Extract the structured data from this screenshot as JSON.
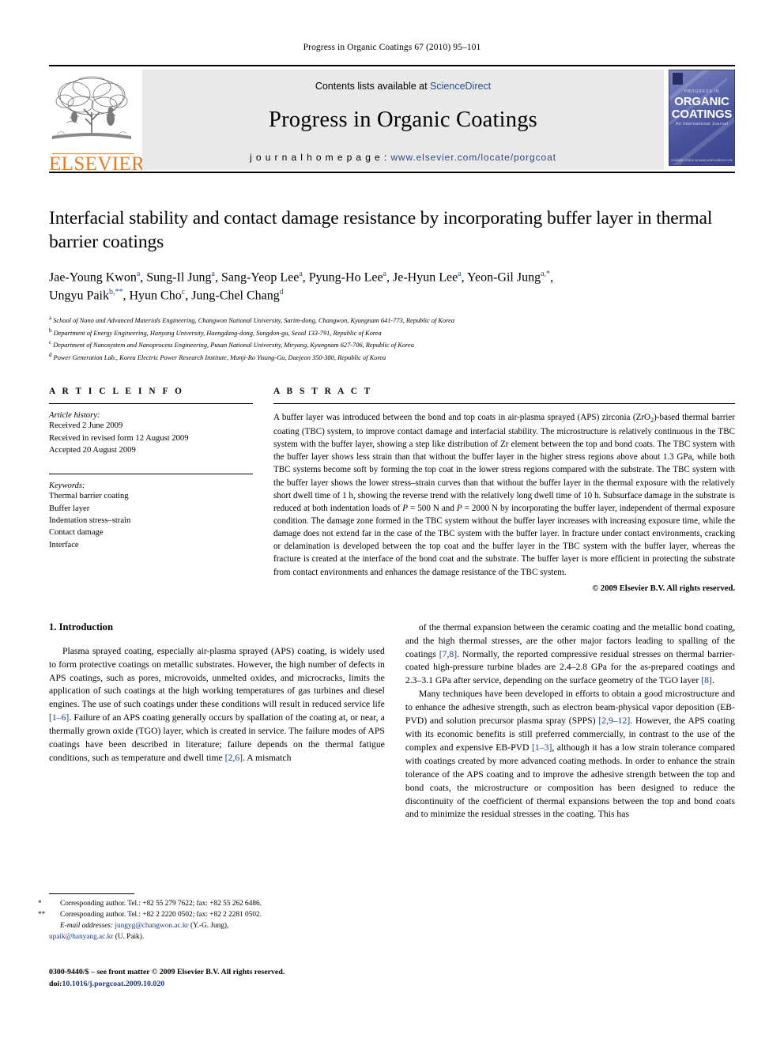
{
  "running_head": "Progress in Organic Coatings 67 (2010) 95–101",
  "masthead": {
    "contents_prefix": "Contents lists available at ",
    "sciencedirect": "ScienceDirect",
    "journal_title": "Progress in Organic Coatings",
    "homepage_prefix": "j o u r n a l   h o m e p a g e :   ",
    "homepage_url": "www.elsevier.com/locate/porgcoat",
    "publisher": "ELSEVIER",
    "cover": {
      "progress_in": "PROGRESS IN",
      "organic": "ORGANIC",
      "coatings": "COATINGS",
      "subtitle": "An International Journal",
      "footer": "Available online at www.sciencedirect.com"
    }
  },
  "article": {
    "title": "Interfacial stability and contact damage resistance by incorporating buffer layer in thermal barrier coatings",
    "authors_line1": "Jae-Young Kwon<sup class=\"aff-mark\">a</sup>, Sung-Il Jung<sup class=\"aff-mark\">a</sup>, Sang-Yeop Lee<sup class=\"aff-mark\">a</sup>, Pyung-Ho Lee<sup class=\"aff-mark\">a</sup>, Je-Hyun Lee<sup class=\"aff-mark\">a</sup>, Yeon-Gil Jung<sup class=\"aff-mark\">a,*</sup>,",
    "authors_line2": "Ungyu Paik<sup class=\"aff-mark\">b,**</sup>, Hyun Cho<sup class=\"aff-mark\">c</sup>, Jung-Chel Chang<sup class=\"aff-mark\">d</sup>",
    "affiliations": [
      {
        "label": "a",
        "text": "School of Nano and Advanced Materials Engineering, Changwon National University, Sarim-dong, Changwon, Kyungnam 641-773, Republic of Korea"
      },
      {
        "label": "b",
        "text": "Department of Energy Engineering, Hanyang University, Haengdang-dong, Sungdon-gu, Seoul 133-791, Republic of Korea"
      },
      {
        "label": "c",
        "text": "Department of Nanosystem and Nanoprocess Engineering, Pusan National University, Miryang, Kyungnam 627-706, Republic of Korea"
      },
      {
        "label": "d",
        "text": "Power Generation Lab., Korea Electric Power Research Institute, Munji-Ro Yisung-Gu, Daejeon 350-380, Republic of Korea"
      }
    ]
  },
  "article_info": {
    "heading": "A R T I C L E    I N F O",
    "history_label": "Article history:",
    "history": [
      "Received 2 June 2009",
      "Received in revised form 12 August 2009",
      "Accepted 20 August 2009"
    ],
    "keywords_label": "Keywords:",
    "keywords": [
      "Thermal barrier coating",
      "Buffer layer",
      "Indentation stress–strain",
      "Contact damage",
      "Interface"
    ]
  },
  "abstract": {
    "heading": "A B S T R A C T",
    "text": "A buffer layer was introduced between the bond and top coats in air-plasma sprayed (APS) zirconia (ZrO<sub>2</sub>)-based thermal barrier coating (TBC) system, to improve contact damage and interfacial stability. The microstructure is relatively continuous in the TBC system with the buffer layer, showing a step like distribution of Zr element between the top and bond coats. The TBC system with the buffer layer shows less strain than that without the buffer layer in the higher stress regions above about 1.3 GPa, while both TBC systems become soft by forming the top coat in the lower stress regions compared with the substrate. The TBC system with the buffer layer shows the lower stress–strain curves than that without the buffer layer in the thermal exposure with the relatively short dwell time of 1 h, showing the reverse trend with the relatively long dwell time of 10 h. Subsurface damage in the substrate is reduced at both indentation loads of <i>P</i> = 500 N and <i>P</i> = 2000 N by incorporating the buffer layer, independent of thermal exposure condition. The damage zone formed in the TBC system without the buffer layer increases with increasing exposure time, while the damage does not extend far in the case of the TBC system with the buffer layer. In fracture under contact environments, cracking or delamination is developed between the top coat and the buffer layer in the TBC system with the buffer layer, whereas the fracture is created at the interface of the bond coat and the substrate. The buffer layer is more efficient in protecting the substrate from contact environments and enhances the damage resistance of the TBC system.",
    "copyright": "© 2009 Elsevier B.V. All rights reserved."
  },
  "introduction": {
    "heading": "1.  Introduction",
    "left_paragraphs": [
      "Plasma sprayed coating, especially air-plasma sprayed (APS) coating, is widely used to form protective coatings on metallic substrates. However, the high number of defects in APS coatings, such as pores, microvoids, unmelted oxides, and microcracks, limits the application of such coatings at the high working temperatures of gas turbines and diesel engines. The use of such coatings under these conditions will result in reduced service life <span class=\"ref\">[1–6]</span>. Failure of an APS coating generally occurs by spallation of the coating at, or near, a thermally grown oxide (TGO) layer, which is created in service. The failure modes of APS coatings have been described in literature; failure depends on the thermal fatigue conditions, such as temperature and dwell time <span class=\"ref\">[2,6]</span>. A mismatch"
    ],
    "right_paragraphs": [
      "of the thermal expansion between the ceramic coating and the metallic bond coating, and the high thermal stresses, are the other major factors leading to spalling of the coatings <span class=\"ref\">[7,8]</span>. Normally, the reported compressive residual stresses on thermal barrier-coated high-pressure turbine blades are 2.4–2.8 GPa for the as-prepared coatings and 2.3–3.1 GPa after service, depending on the surface geometry of the TGO layer <span class=\"ref\">[8]</span>.",
      "Many techniques have been developed in efforts to obtain a good microstructure and to enhance the adhesive strength, such as electron beam-physical vapor deposition (EB-PVD) and solution precursor plasma spray (SPPS) <span class=\"ref\">[2,9–12]</span>. However, the APS coating with its economic benefits is still preferred commercially, in contrast to the use of the complex and expensive EB-PVD <span class=\"ref\">[1–3]</span>, although it has a low strain tolerance compared with coatings created by more advanced coating methods. In order to enhance the strain tolerance of the APS coating and to improve the adhesive strength between the top and bond coats, the microstructure or composition has been designed to reduce the discontinuity of the coefficient of thermal expansions between the top and bond coats and to minimize the residual stresses in the coating. This has"
    ]
  },
  "footnotes": {
    "corresponding_1": "Corresponding author. Tel.: +82 55 279 7622; fax: +82 55 262 6486.",
    "corresponding_2": "Corresponding author. Tel.: +82 2 2220 0502; fax: +82 2 2281 0502.",
    "email_label": "E-mail addresses:",
    "email_1": "jungyg@changwon.ac.kr",
    "email_1_owner": "(Y.-G. Jung),",
    "email_2": "upaik@hanyang.ac.kr",
    "email_2_owner": "(U. Paik).",
    "star_1": "*",
    "star_2": "**"
  },
  "imprint": {
    "line1": "0300-9440/$ – see front matter © 2009 Elsevier B.V. All rights reserved.",
    "doi_label": "doi:",
    "doi_value": "10.1016/j.porgcoat.2009.10.020"
  }
}
